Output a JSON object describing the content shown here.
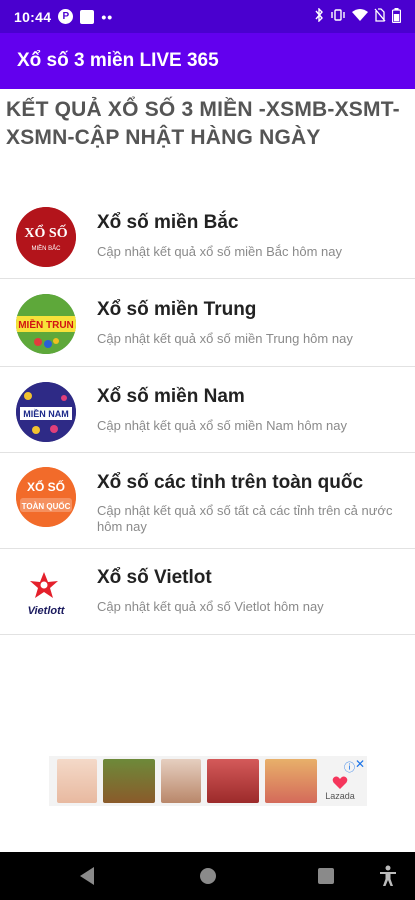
{
  "status_bar": {
    "time": "10:44",
    "icons": [
      "notification-icon",
      "square-icon",
      "dots-icon",
      "bluetooth-icon",
      "vibrate-icon",
      "wifi-icon",
      "battery-icon"
    ]
  },
  "app_bar": {
    "title": "Xổ số 3 miền LIVE 365"
  },
  "headline": "KẾT QUẢ XỔ SỐ 3 MIỀN -XSMB-XSMT-XSMN-CẬP NHẬT HÀNG NGÀY",
  "lottery_list": [
    {
      "title": "Xổ số miền Bắc",
      "description": "Cập nhật kết quả xổ số miền Bắc hôm nay",
      "logo_text": "XỔ SỐ",
      "logo_sub": "MIỀN BẮC"
    },
    {
      "title": "Xổ số miền Trung",
      "description": "Cập nhật kết quả xổ số miền Trung hôm nay",
      "logo_text": "MIỀN TRUN"
    },
    {
      "title": "Xổ số miền Nam",
      "description": "Cập nhật kết quả xổ số miền Nam hôm nay",
      "logo_text": "MIỀN NAM"
    },
    {
      "title": "Xổ số các tỉnh trên toàn quốc",
      "description": "Cập nhật kết quả xổ số tất cả các tỉnh trên cả nước hôm nay",
      "logo_text": "XỔ SỐ",
      "logo_sub": "TOÀN QUỐC"
    },
    {
      "title": "Xổ số Vietlot",
      "description": "Cập nhật kết quả xổ số Vietlot hôm nay",
      "logo_text": "Vietlott"
    }
  ],
  "ad_banner": {
    "brand": "Lazada"
  },
  "colors": {
    "status_bar": "#4a00cf",
    "app_bar": "#6200ee",
    "headline": "#555555",
    "description": "#8a8a8a"
  }
}
